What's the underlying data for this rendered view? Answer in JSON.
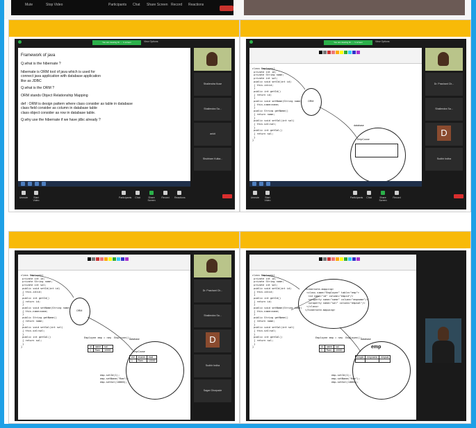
{
  "top_strip": {
    "texts": [
      "Mute",
      "Stop Video",
      "Participants",
      "Chat",
      "Share Screen",
      "Record",
      "Reactions"
    ]
  },
  "zoom": {
    "green_banner": "You are viewing Dr. ... 's screen",
    "view_options": "View Options",
    "controls": [
      "Unmute",
      "Start Video",
      "Participants",
      "Chat",
      "Share Screen",
      "Record",
      "Reactions"
    ]
  },
  "panels": [
    {
      "participants": [
        "",
        "Shailendra Kuse",
        "Shailendra Sa...",
        "ankit",
        "Shubham Kulka...",
        "Pranav"
      ],
      "notes": [
        "Framework of java",
        "Q.what is the hibernate ?",
        "hibernate is ORM tool of java which is used for",
        "connect java application with database application",
        "like as JDBC",
        "Q.what is the ORM ?",
        "ORM stands Object Relationship Mapping",
        "def : ORM is design pattern where class consider as table in database",
        "class field consider as column in database table",
        "class object consider as row in database table.",
        "Q.why use the hibernate if we have jdbc already ?"
      ]
    },
    {
      "participants": [
        "",
        "Dr. Prashant Ch...",
        "Shailendra Sa...",
        "D",
        "Sudhir Indha",
        "Sudhir more is"
      ],
      "code": [
        "class Employee{",
        " private int id;",
        " private String name;",
        " private int sal;",
        "",
        " public void setId(int id)",
        " { this.id=id;",
        " }",
        " public int getId()",
        " { return id;",
        " }",
        " public void setName(String name)",
        " { this.name=name;",
        " }",
        " public String getName()",
        " { return name;",
        " }",
        " public void setSal(int sal)",
        " { this.sal=sal;",
        " }",
        " public int getSal()",
        " { return sal;",
        " }",
        "}"
      ],
      "circle_label": "ORM",
      "db_label": "database",
      "table_label": "EmpCouse"
    },
    {
      "participants": [
        "",
        "Dr. Prashant Ch...",
        "Shailendra Sa...",
        "D",
        "Sudhir Indha",
        "Sagar Ghorpade"
      ],
      "code_right": [
        "Employee emp = new  Employee();",
        "",
        "emp.setId(1);",
        "emp.setName(\"Ram\");",
        "emp.setSal(10000);"
      ],
      "table_headers": [
        "id",
        "name",
        "sal"
      ],
      "table_row": [
        "1",
        "Ram",
        "10000"
      ],
      "db_table_headers": [
        "eid",
        "ename",
        "esal"
      ],
      "db_table_row": [
        "1",
        "Ram",
        "10000"
      ]
    },
    {
      "xml": [
        "<hibernate-mapping>",
        " <class name=\"Employee\" table=\"emp\">",
        "  <id name=\"id\" column=\"empid\"/>",
        "  <property name=\"name\" column=\"empname\"/>",
        "  <property name=\"sal\" column=\"empsal\"/>",
        " </class>",
        "</hibernate-mapping>"
      ],
      "emp_label": "emp",
      "db_table_headers": [
        "empid",
        "empname",
        "empsal"
      ]
    }
  ]
}
